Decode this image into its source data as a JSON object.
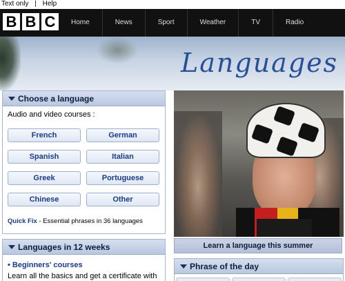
{
  "utility": {
    "text_only": "Text only",
    "separator": "|",
    "help": "Help"
  },
  "logo": {
    "letters": [
      "B",
      "B",
      "C"
    ]
  },
  "nav": {
    "items": [
      "Home",
      "News",
      "Sport",
      "Weather",
      "TV",
      "Radio"
    ]
  },
  "banner": {
    "title": "Languages"
  },
  "choose_panel": {
    "heading": "Choose a language",
    "subheading": "Audio and video courses :",
    "languages": [
      "French",
      "German",
      "Spanish",
      "Italian",
      "Greek",
      "Portuguese",
      "Chinese",
      "Other"
    ],
    "quick_fix_label": "Quick Fix",
    "quick_fix_text": " - Essential phrases in 36 languages"
  },
  "weeks_panel": {
    "heading": "Languages in 12 weeks",
    "link": "• Beginners' courses",
    "description": "Learn all the basics and get a certificate with"
  },
  "promo": {
    "caption": "Learn a language this summer"
  },
  "phrase_panel": {
    "heading": "Phrase of the day"
  },
  "colors": {
    "accent": "#264f96",
    "link": "#1a3a8a",
    "panel_header": "#b9c7e0"
  }
}
